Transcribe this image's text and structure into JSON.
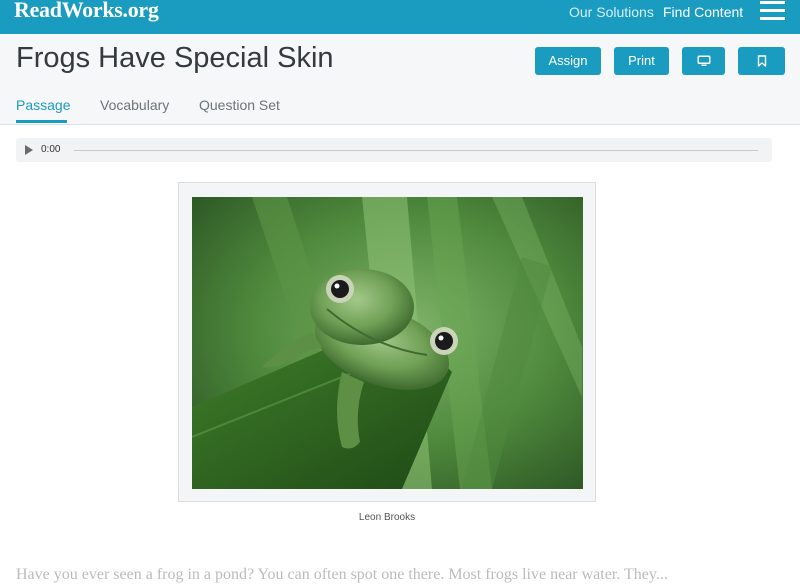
{
  "header": {
    "logo": "ReadWorks.org",
    "nav": [
      "Our Solutions",
      "Find Content"
    ],
    "menu_icon": "hamburger-icon"
  },
  "title_bar": {
    "title": "Frogs Have Special Skin",
    "buttons": {
      "assign": "Assign",
      "print": "Print",
      "present_icon": "monitor-icon",
      "bookmark_icon": "bookmark-icon"
    }
  },
  "tabs": {
    "items": [
      "Passage",
      "Vocabulary",
      "Question Set"
    ],
    "active": "Passage"
  },
  "audio": {
    "time": "0:00",
    "play_icon": "play-icon"
  },
  "figure": {
    "caption": "Leon Brooks"
  },
  "passage": {
    "text": "Have you ever seen a frog in a pond? You can often spot one there. Most frogs live near water. They..."
  },
  "colors": {
    "brand": "#1a9cc0",
    "title_bar_bg": "#f6f7f8",
    "text_dark": "#333a40"
  }
}
